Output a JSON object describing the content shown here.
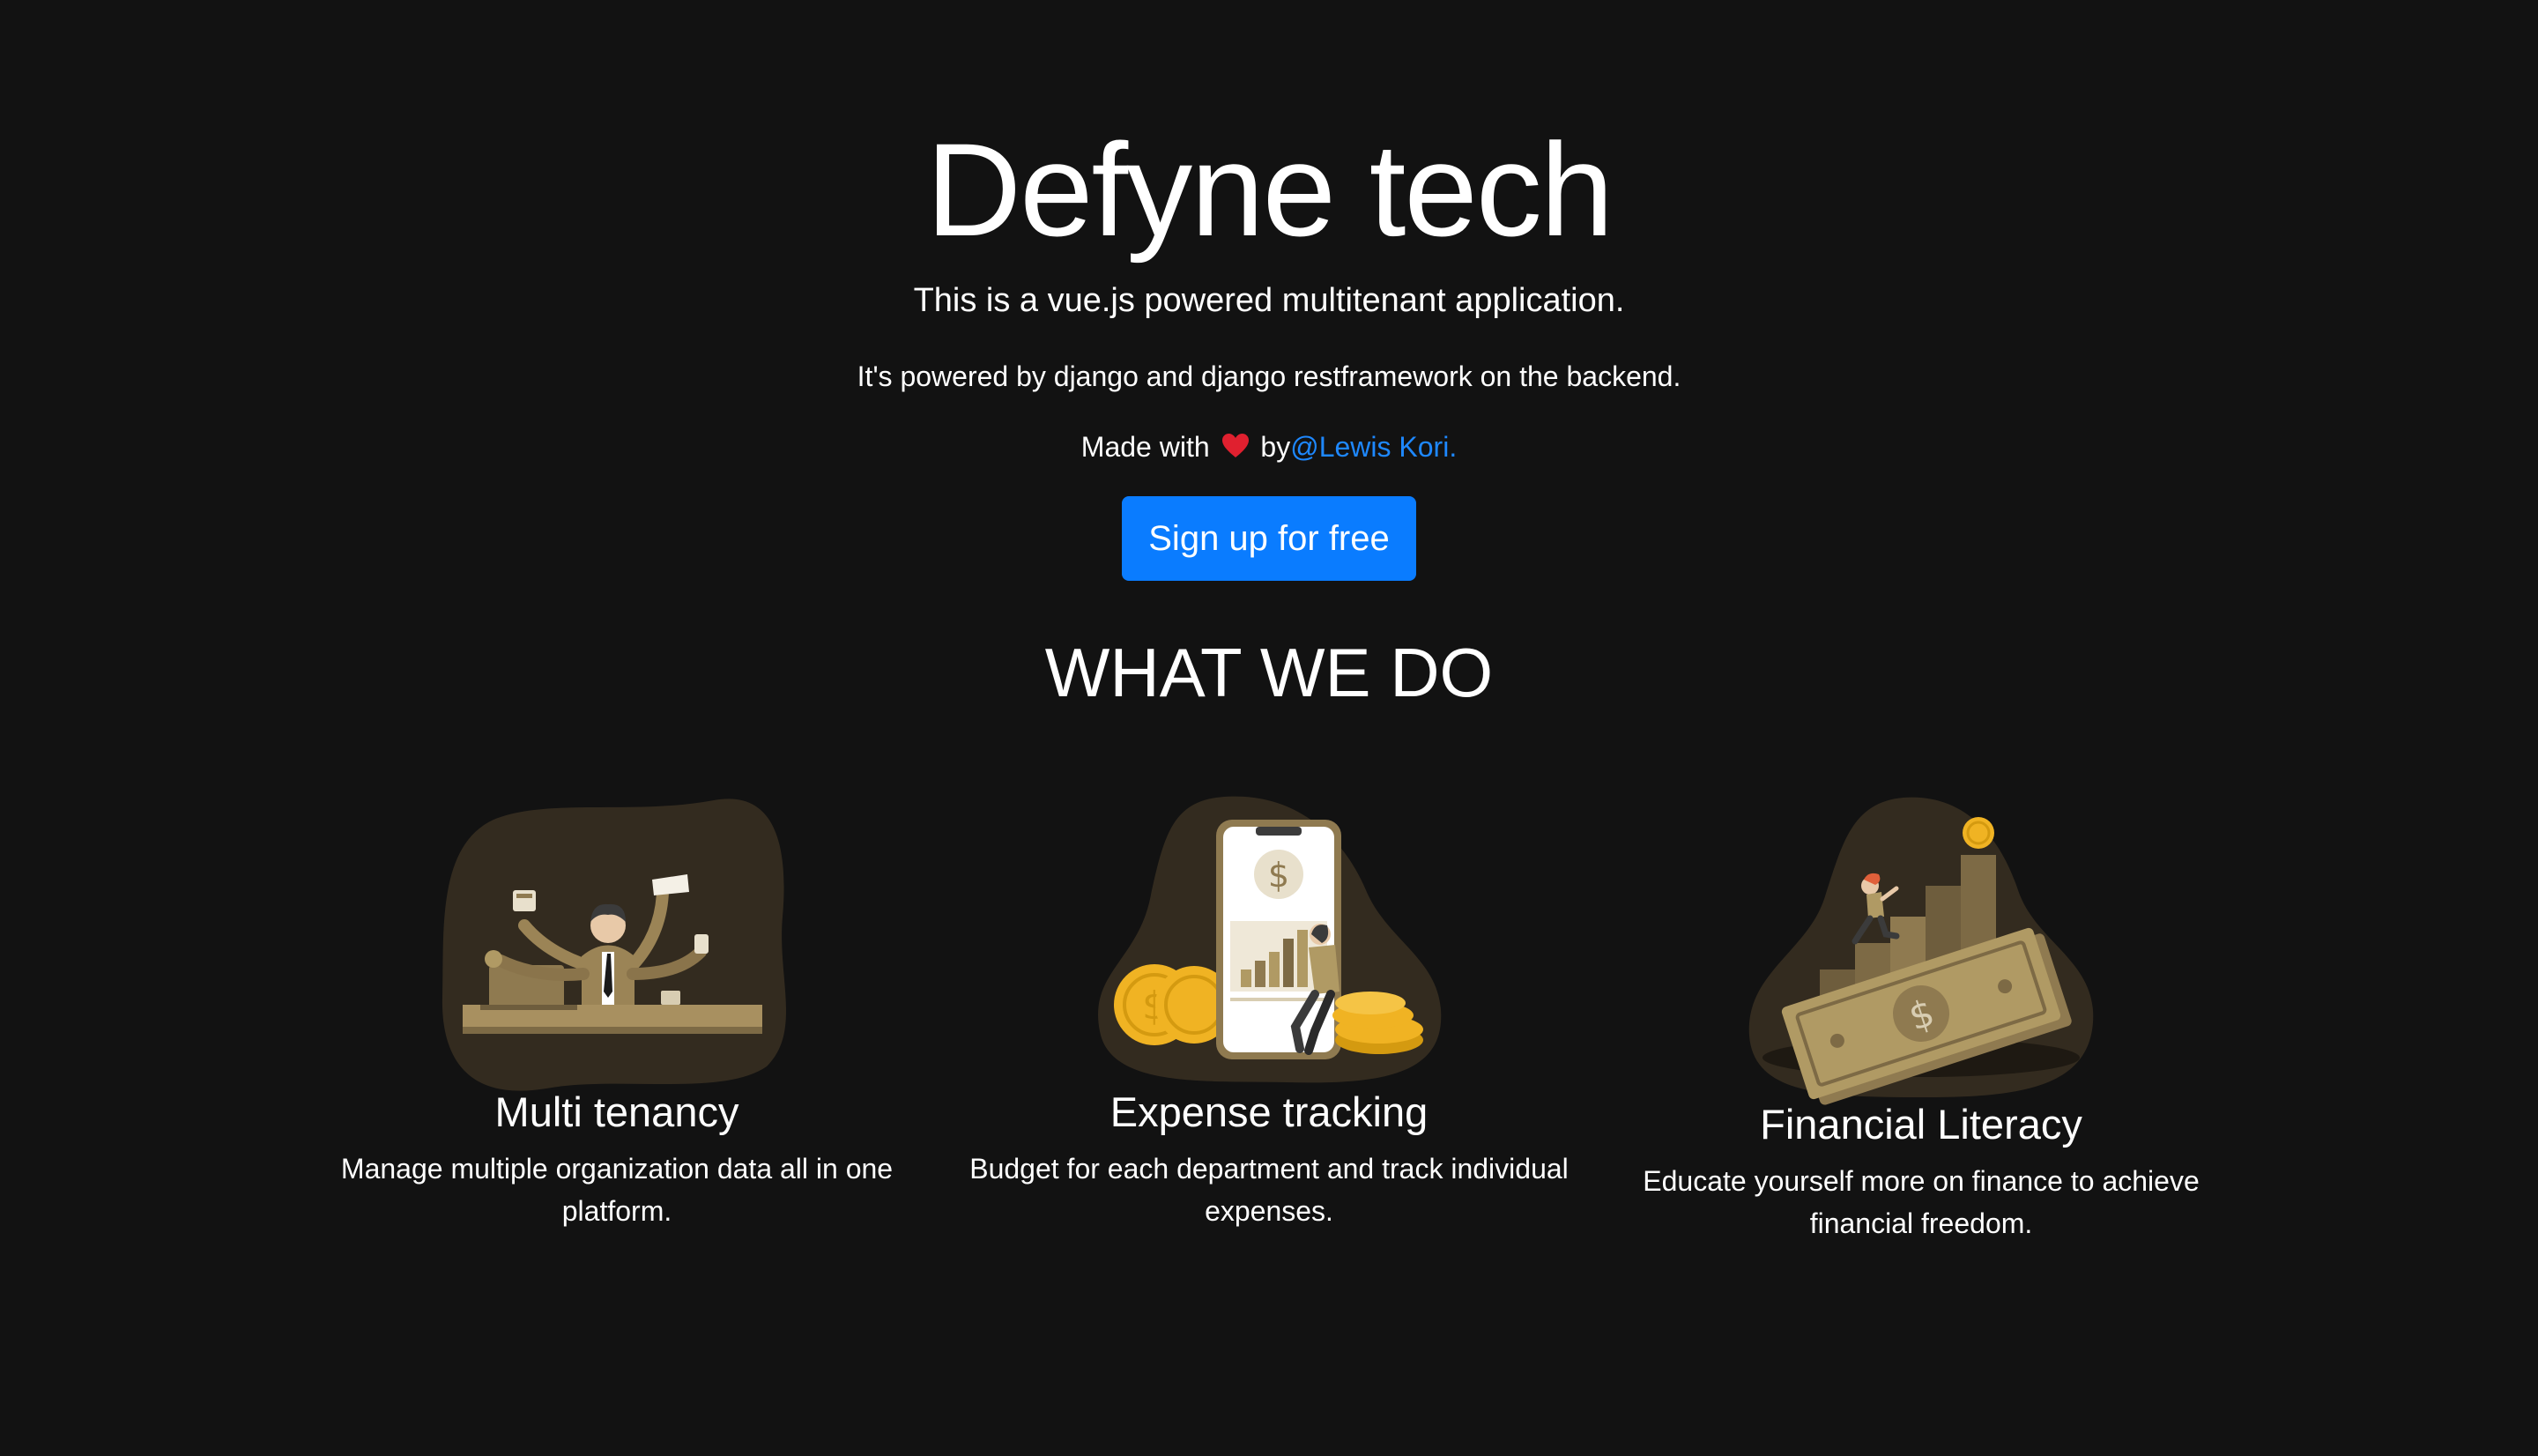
{
  "hero": {
    "title": "Defyne tech",
    "lead": "This is a vue.js powered multitenant application.",
    "sub": "It's powered by django and django restframework on the backend.",
    "credit_prefix": "Made with",
    "credit_by": "by",
    "author_link": "@Lewis Kori.",
    "signup_label": "Sign up for free"
  },
  "section": {
    "title": "WHAT WE DO"
  },
  "features": [
    {
      "icon": "multitasking-businessman-illustration",
      "title": "Multi tenancy",
      "text": "Manage multiple organization data all in one platform."
    },
    {
      "icon": "phone-coins-expense-illustration",
      "title": "Expense tracking",
      "text": "Budget for each department and track individual expenses."
    },
    {
      "icon": "money-stairs-growth-illustration",
      "title": "Financial Literacy",
      "text": "Educate yourself more on finance to achieve financial freedom."
    }
  ],
  "colors": {
    "background": "#121212",
    "primary_button": "#0a7cff",
    "link": "#1e88ff",
    "illustration_blob": "#332b1f",
    "illustration_gold": "#b09a64"
  }
}
